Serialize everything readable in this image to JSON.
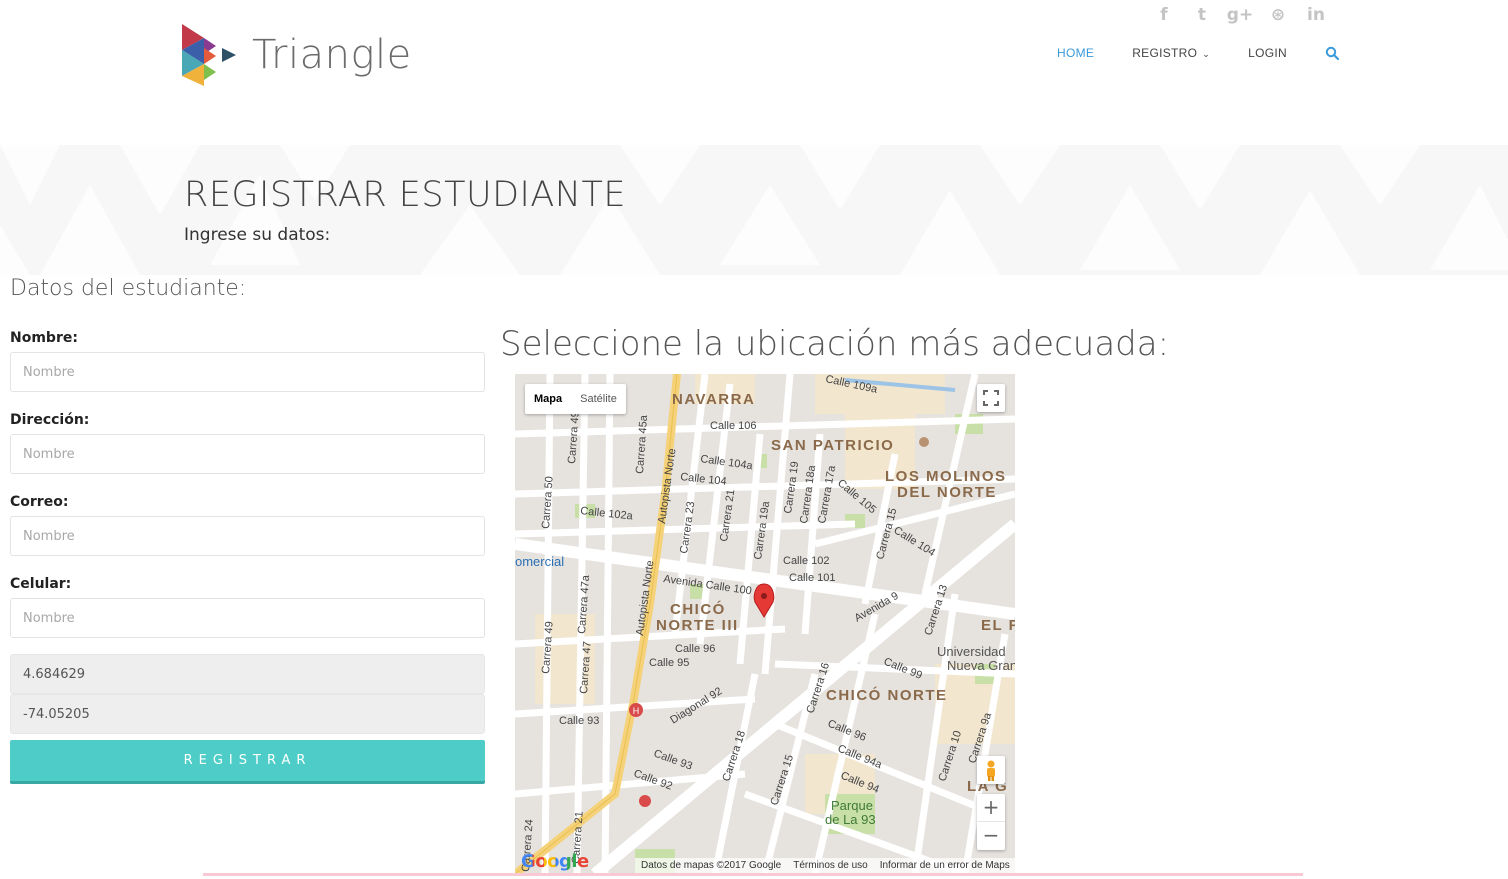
{
  "brand": {
    "name": "Triangle"
  },
  "social": [
    {
      "icon": "facebook-icon",
      "glyph": "f"
    },
    {
      "icon": "twitter-icon",
      "glyph": "t"
    },
    {
      "icon": "google-plus-icon",
      "glyph": "g+"
    },
    {
      "icon": "dribbble-icon",
      "glyph": "⊛"
    },
    {
      "icon": "linkedin-icon",
      "glyph": "in"
    }
  ],
  "nav": {
    "home": "HOME",
    "registro": "REGISTRO",
    "login": "LOGIN",
    "active_color": "#3a9ad9"
  },
  "banner": {
    "title": "REGISTRAR ESTUDIANTE",
    "subtitle": "Ingrese su datos:"
  },
  "form": {
    "section_title": "Datos del estudiante:",
    "nombre_label": "Nombre:",
    "nombre_placeholder": "Nombre",
    "direccion_label": "Dirección:",
    "direccion_placeholder": "Nombre",
    "correo_label": "Correo:",
    "correo_placeholder": "Nombre",
    "celular_label": "Celular:",
    "celular_placeholder": "Nombre",
    "latitude": "4.684629",
    "longitude": "-74.05205",
    "submit_label": "Registrar",
    "button_color": "#4ecdc8"
  },
  "map": {
    "title": "Seleccione la ubicación más adecuada:",
    "type_map": "Mapa",
    "type_satellite": "Satélite",
    "zoom_in": "+",
    "zoom_out": "−",
    "google": "Google",
    "footer_data": "Datos de mapas ©2017 Google",
    "footer_terms": "Términos de uso",
    "footer_report": "Informar de un error de Maps",
    "labels": {
      "navarra": "NAVARRA",
      "san_patricio": "SAN PATRICIO",
      "molinos_1": "LOS MOLINOS",
      "molinos_2": "DEL NORTE",
      "chico_norte_iii_1": "CHICÓ",
      "chico_norte_iii_2": "NORTE III",
      "chico_norte": "CHICÓ NORTE",
      "el_f": "EL F",
      "universidad_1": "Universidad",
      "universidad_2": "Nueva Gran",
      "la_g": "LA G",
      "parque_1": "Parque",
      "parque_2": "de La 93",
      "comercial": "omercial",
      "avenida_calle_100": "Avenida Calle 100",
      "autopista_norte": "Autopista Norte",
      "avenida_9": "Avenida 9",
      "diagonal_92": "Diagonal 92",
      "calle_106": "Calle 106",
      "calle_104a": "Calle 104a",
      "calle_104": "Calle 104",
      "calle_102a": "Calle 102a",
      "calle_102": "Calle 102",
      "calle_101": "Calle 101",
      "calle_96": "Calle 96",
      "calle_95": "Calle 95",
      "calle_93": "Calle 93",
      "calle_92": "Calle 92",
      "calle_99": "Calle 99",
      "calle_94a": "Calle 94a",
      "calle_94": "Calle 94",
      "calle_109a": "Calle 109a",
      "calle_105": "Calle 105",
      "calle_104_e": "Calle 104",
      "carrera_19": "Carrera 19",
      "carrera_18a": "Carrera 18a",
      "carrera_17a": "Carrera 17a",
      "carrera_21": "Carrera 21",
      "carrera_23": "Carrera 23",
      "carrera_19a": "Carrera 19a",
      "carrera_15": "Carrera 15",
      "carrera_13": "Carrera 13",
      "carrera_16": "Carrera 16",
      "carrera_18": "Carrera 18",
      "carrera_10": "Carrera 10",
      "carrera_9a": "Carrera 9a",
      "carrera_49": "Carrera 49",
      "carrera_47": "Carrera 47",
      "carrera_47a": "Carrera 47a",
      "carrera_50": "Carrera 50",
      "carrera_49b": "Carrera 49b",
      "carrera_45a": "Carrera 45a",
      "carrera_24": "Carrera 24",
      "carrera_21_s": "Carrera 21"
    }
  }
}
